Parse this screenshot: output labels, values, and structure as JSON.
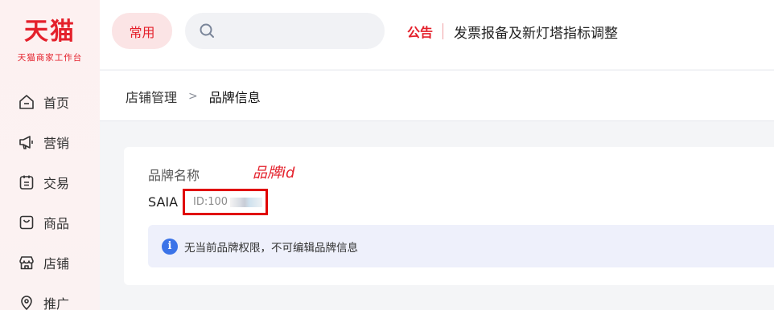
{
  "brand": {
    "logo": "天猫",
    "subtitle": "天猫商家工作台"
  },
  "sidebar": {
    "items": [
      {
        "label": "首页",
        "icon": "home-icon"
      },
      {
        "label": "营销",
        "icon": "megaphone-icon"
      },
      {
        "label": "交易",
        "icon": "trade-icon"
      },
      {
        "label": "商品",
        "icon": "shopping-bag-icon"
      },
      {
        "label": "店铺",
        "icon": "store-icon"
      },
      {
        "label": "推广",
        "icon": "location-icon"
      }
    ]
  },
  "header": {
    "quick_label": "常用",
    "search": {
      "placeholder": "",
      "icon": "search-icon"
    },
    "notice": {
      "label": "公告",
      "text": "发票报备及新灯塔指标调整"
    }
  },
  "breadcrumb": {
    "parent": "店铺管理",
    "separator": ">",
    "current": "品牌信息"
  },
  "card": {
    "field_label": "品牌名称",
    "annotation": "品牌id",
    "brand_name": "SAIA",
    "brand_id": "ID:100",
    "info_text": "无当前品牌权限，不可编辑品牌信息"
  },
  "colors": {
    "accent": "#e4202b",
    "info_blue": "#3b73e8",
    "highlight_box": "#e00000"
  }
}
